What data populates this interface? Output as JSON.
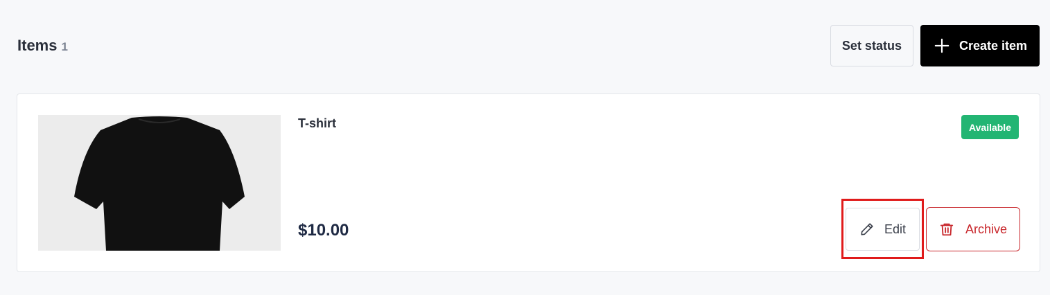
{
  "header": {
    "title": "Items",
    "count": "1",
    "set_status_label": "Set status",
    "create_item_label": "Create item",
    "create_item_icon": "plus-icon"
  },
  "item": {
    "name": "T-shirt",
    "price": "$10.00",
    "status": "Available",
    "status_color": "#22b573",
    "image": "black-tshirt-image",
    "edit_label": "Edit",
    "edit_icon": "pencil-icon",
    "archive_label": "Archive",
    "archive_icon": "trash-icon",
    "archive_color": "#c8262b"
  },
  "highlight_color": "#e01b1b"
}
